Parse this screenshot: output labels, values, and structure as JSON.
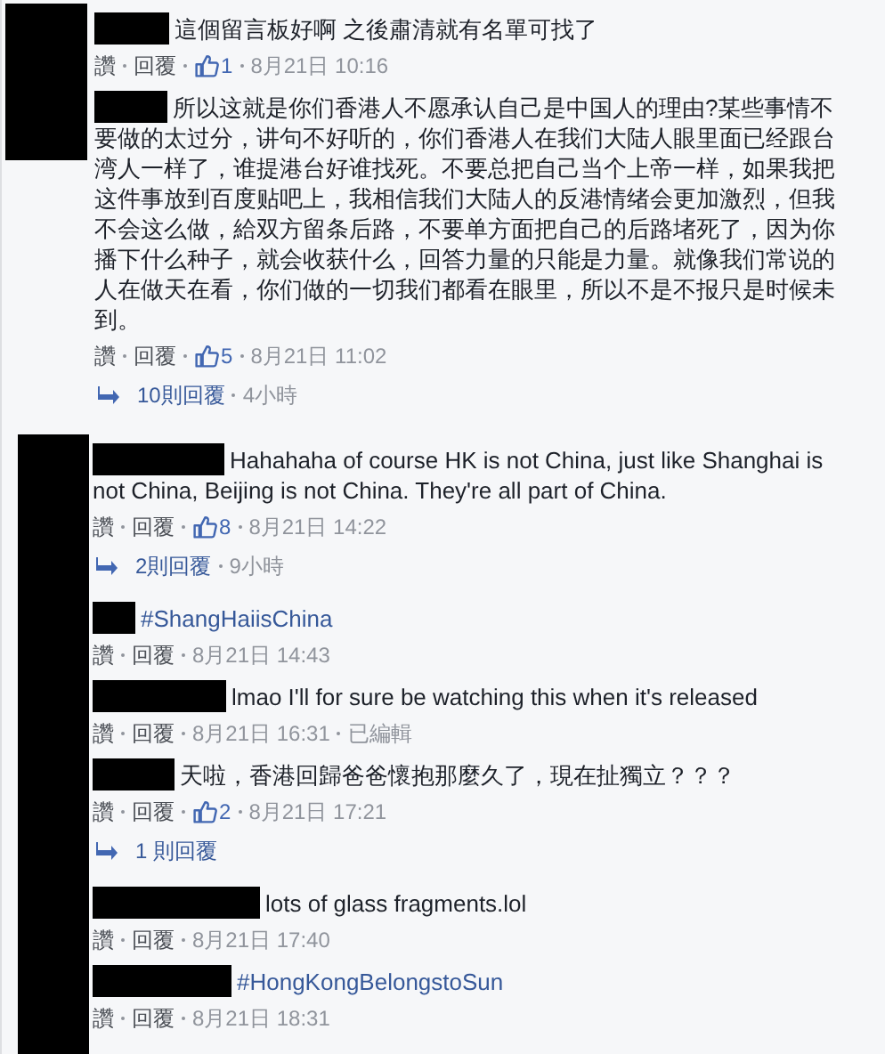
{
  "threads": [
    {
      "items": [
        {
          "kind": "comment",
          "text": "這個留言板好啊 之後肅清就有名單可找了",
          "like_label": "讚",
          "reply_label": "回覆",
          "likes": "1",
          "time": "8月21日 10:16"
        },
        {
          "kind": "comment",
          "text": "所以这就是你们香港人不愿承认自己是中国人的理由?某些事情不要做的太过分，讲句不好听的，你们香港人在我们大陆人眼里面已经跟台湾人一样了，谁提港台好谁找死。不要总把自己当个上帝一样，如果我把这件事放到百度贴吧上，我相信我们大陆人的反港情绪会更加激烈，但我不会这么做，給双方留条后路，不要单方面把自己的后路堵死了，因为你播下什么种子，就会收获什么，回答力量的只能是力量。就像我们常说的人在做天在看，你们做的一切我们都看在眼里，所以不是不报只是时候未到。",
          "like_label": "讚",
          "reply_label": "回覆",
          "likes": "5",
          "time": "8月21日 11:02"
        },
        {
          "kind": "replies",
          "label": "10則回覆",
          "age": "4小時"
        }
      ]
    },
    {
      "items": [
        {
          "kind": "comment",
          "text": "Hahahaha of course HK is not China, just like Shanghai is not China, Beijing is not China. They're all part of China.",
          "like_label": "讚",
          "reply_label": "回覆",
          "likes": "8",
          "time": "8月21日 14:22"
        },
        {
          "kind": "replies",
          "label": "2則回覆",
          "age": "9小時"
        },
        {
          "kind": "comment",
          "text": "#ShangHaiisChina",
          "hashtag": true,
          "like_label": "讚",
          "reply_label": "回覆",
          "time": "8月21日 14:43"
        },
        {
          "kind": "comment",
          "text": "lmao I'll for sure be watching this when it's released",
          "like_label": "讚",
          "reply_label": "回覆",
          "time": "8月21日 16:31",
          "edited": "已編輯"
        },
        {
          "kind": "comment",
          "text": "天啦，香港回歸爸爸懷抱那麼久了，現在扯獨立？？？",
          "like_label": "讚",
          "reply_label": "回覆",
          "likes": "2",
          "time": "8月21日 17:21"
        },
        {
          "kind": "replies",
          "label": "1 則回覆"
        },
        {
          "kind": "comment",
          "text": "lots of glass fragments.lol",
          "like_label": "讚",
          "reply_label": "回覆",
          "time": "8月21日 17:40"
        },
        {
          "kind": "comment",
          "text": "#HongKongBelongstoSun",
          "hashtag": true,
          "like_label": "讚",
          "reply_label": "回覆",
          "time": "8月21日 18:31"
        }
      ]
    }
  ]
}
